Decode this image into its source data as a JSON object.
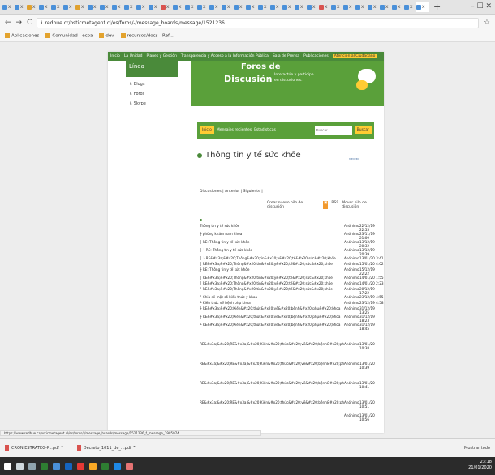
{
  "browser": {
    "tabs": [
      {
        "fav": "#4a90d9"
      },
      {
        "fav": "#4a90d9"
      },
      {
        "fav": "#e0a12e"
      },
      {
        "fav": "#4a90d9"
      },
      {
        "fav": "#4a90d9"
      },
      {
        "fav": "#4a90d9"
      },
      {
        "fav": "#e0a12e"
      },
      {
        "fav": "#4a90d9"
      },
      {
        "fav": "#4a90d9"
      },
      {
        "fav": "#4a90d9"
      },
      {
        "fav": "#4a90d9"
      },
      {
        "fav": "#4a90d9"
      },
      {
        "fav": "#4a90d9"
      },
      {
        "fav": "#d9534f"
      },
      {
        "fav": "#4a90d9"
      },
      {
        "fav": "#4a90d9"
      },
      {
        "fav": "#4a90d9"
      },
      {
        "fav": "#4a90d9"
      },
      {
        "fav": "#4a90d9"
      },
      {
        "fav": "#4a90d9"
      },
      {
        "fav": "#4a90d9"
      },
      {
        "fav": "#4a90d9"
      },
      {
        "fav": "#4a90d9"
      },
      {
        "fav": "#4a90d9"
      },
      {
        "fav": "#4a90d9"
      },
      {
        "fav": "#4a90d9"
      },
      {
        "fav": "#d9534f"
      },
      {
        "fav": "#4a90d9"
      },
      {
        "fav": "#4a90d9"
      },
      {
        "fav": "#4a90d9"
      },
      {
        "fav": "#4a90d9"
      },
      {
        "fav": "#4a90d9"
      },
      {
        "fav": "#4a90d9"
      },
      {
        "fav": "#4a90d9"
      },
      {
        "fav": "#4a90d9"
      }
    ],
    "active_tab_close": "x",
    "new_tab": "+",
    "window_controls": "–  ☐  ✕",
    "back": "←",
    "forward": "→",
    "reload": "C",
    "url": "redhue.cr/osticmetagent.cl/es/foros/-/message_boards/message/1521236",
    "star": "☆",
    "bookmarks": [
      "Aplicaciones",
      "Comunidad - ecoa",
      "dev",
      "recursos/docs - Ref..."
    ]
  },
  "site": {
    "nav": [
      "Inicio",
      "La Unidad",
      "Planes y Gestión",
      "Transparencia y Acceso a la Información Pública",
      "Sala de Prensa",
      "Publicaciones",
      "Atención al Ciudadano"
    ],
    "sidebar_title": "Línea",
    "sidebar_items": [
      "↳ Blogs",
      "↳ Foros",
      "↳ Skype"
    ],
    "hero_title1": "Foros de",
    "hero_title2": "Discusión",
    "hero_sub": "Interactúe y participe en discusiones.",
    "tabs": [
      "Inicio",
      "Mensajes recientes",
      "Estadísticas"
    ],
    "search_placeholder": "Buscar",
    "search_button": "Buscar",
    "thread_title": "Thông tin y tế sức khỏe",
    "pager_icons": "▭▭▭",
    "crumbs": "Discusiones | Anterior | Siguiente |",
    "new_thread": "Crear nuevo hilo de discusión",
    "rss": "RSS",
    "move": "Mover hilo de discusión",
    "rows": [
      {
        "s": "Thông tin y tế sức khỏe",
        "a": "Anónimo",
        "d": "22/12/19 22:55"
      },
      {
        "s": "├ phòng khám nam khoa",
        "a": "Anónimo",
        "d": "23/11/19 21:09"
      },
      {
        "s": "├ RE: Thông tin y tế sức khỏe",
        "a": "Anónimo",
        "d": "13/12/19 20:32"
      },
      {
        "s": "│ └ RE: Thông tin y tế sức khỏe",
        "a": "Anónimo",
        "d": "13/12/19 20:39"
      },
      {
        "s": "│   └ RE&#x3a;&#x20;Thông&#x20;tin&#x20;y&#x20;tế&#x20;sức&#x20;khỏe",
        "a": "Anónimo",
        "d": "13/01/20 3:41"
      },
      {
        "s": "│     RE&#x3a;&#x20;Thông&#x20;tin&#x20;y&#x20;tế&#x20;sức&#x20;khỏe",
        "a": "Anónimo",
        "d": "15/01/20 4:02"
      },
      {
        "s": "├ RE: Thông tin y tế sức khỏe",
        "a": "Anónimo",
        "d": "15/12/19 22:22"
      },
      {
        "s": "│ RE&#x3a;&#x20;Thông&#x20;tin&#x20;y&#x20;tế&#x20;sức&#x20;khỏe",
        "a": "Anónimo",
        "d": "14/01/20 1:55"
      },
      {
        "s": "│ RE&#x3a;&#x20;Thông&#x20;tin&#x20;y&#x20;tế&#x20;sức&#x20;khỏe",
        "a": "Anónimo",
        "d": "14/01/20 2:23"
      },
      {
        "s": "└ RE&#x3a;&#x20;Thông&#x20;tin&#x20;y&#x20;tế&#x20;sức&#x20;khỏe",
        "a": "Anónimo",
        "d": "20/12/19 17:22"
      },
      {
        "s": "  └ Chia sẻ một số kiến thức y khoa",
        "a": "Anónimo",
        "d": "23/12/19 4:55"
      },
      {
        "s": "    └ Kiến thức về bệnh phụ khoa",
        "a": "Anónimo",
        "d": "23/12/19 4:58"
      },
      {
        "s": "      ├ RE&#x3a;&#x20;Kiến&#x20;thức&#x20;về&#x20;bệnh&#x20;phụ&#x20;khoa",
        "a": "Anónimo",
        "d": "31/12/19 13:25"
      },
      {
        "s": "      ├ RE&#x3a;&#x20;Kiến&#x20;thức&#x20;về&#x20;bệnh&#x20;phụ&#x20;khoa",
        "a": "Anónimo",
        "d": "31/12/19 18:23"
      },
      {
        "s": "      └ RE&#x3a;&#x20;Kiến&#x20;thức&#x20;về&#x20;bệnh&#x20;phụ&#x20;khoa",
        "a": "Anónimo",
        "d": "31/12/19 18:45"
      },
      {
        "s": "        RE&#x3a;&#x20;RE&#x3a;&#x20;Kiến&#x20;thức&#x20;về&#x20;bệnh&#x20;phụ&#x20;khoa",
        "a": "Anónimo",
        "d": "13/01/20 10:38"
      },
      {
        "s": "        RE&#x3a;&#x20;RE&#x3a;&#x20;Kiến&#x20;thức&#x20;về&#x20;bệnh&#x20;phụ&#x20;khoa",
        "a": "Anónimo",
        "d": "13/01/20 10:39"
      },
      {
        "s": "        RE&#x3a;&#x20;RE&#x3a;&#x20;Kiến&#x20;thức&#x20;về&#x20;bệnh&#x20;phụ&#x20;khoa",
        "a": "Anónimo",
        "d": "13/01/20 10:41"
      },
      {
        "s": "        RE&#x3a;&#x20;RE&#x3a;&#x20;Kiến&#x20;thức&#x20;về&#x20;bệnh&#x20;phụ&#x20;khoa",
        "a": "Anónimo",
        "d": "13/01/20 10:51"
      },
      {
        "s": "",
        "a": "Anónimo",
        "d": "13/01/20 10:56"
      }
    ],
    "row_gaps": [
      0,
      0,
      0,
      0,
      0,
      0,
      0,
      0,
      0,
      0,
      0,
      0,
      0,
      0,
      0,
      14,
      14,
      14,
      14,
      6
    ]
  },
  "status_url": "https://www.redhue.cr/osticmetagent.cl/es/foros/-/message_boards/message/1521236_f_message_1985974",
  "downloads": [
    {
      "name": "CRON.ESTRATEG-P...pdf"
    },
    {
      "name": "Decreto_1011_de_...pdf"
    }
  ],
  "downloads_more": "Mostrar todo",
  "tray": {
    "time": "23:18",
    "date": "21/01/2020"
  },
  "taskbar_colors": [
    "#ffffff",
    "#cfd8dc",
    "#90a4ae",
    "#2e7d32",
    "#4a90d9",
    "#1565c0",
    "#e53935",
    "#f9a825",
    "#2e7d32",
    "#1e88e5",
    "#e57373"
  ]
}
